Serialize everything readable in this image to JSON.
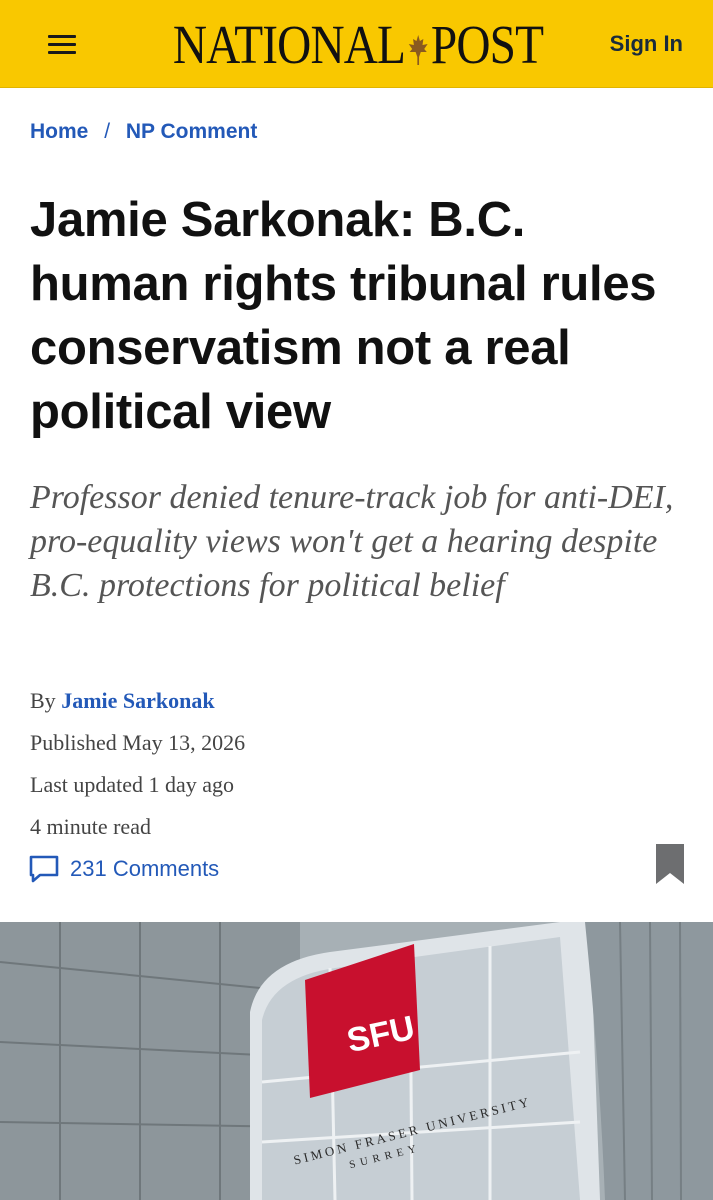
{
  "header": {
    "brand_left": "NATIONAL",
    "brand_right": "POST",
    "signin_label": "Sign In",
    "bg_color": "#f9c800",
    "menu_icon": "hamburger-menu-icon",
    "leaf_icon": "maple-leaf-icon"
  },
  "breadcrumb": {
    "home": "Home",
    "separator": "/",
    "section": "NP Comment",
    "link_color": "#2359b8"
  },
  "article": {
    "headline": "Jamie Sarkonak: B.C. human rights tribunal rules conservatism not a real political view",
    "dek": "Professor denied tenure-track job for anti-DEI, pro-equality views won't get a hearing despite B.C. protections for political belief",
    "byline_prefix": "By",
    "author": "Jamie Sarkonak",
    "published": "Published May 13, 2026",
    "updated": "Last updated 1 day ago",
    "read_time": "4 minute read",
    "comments_label": "231 Comments",
    "comment_icon": "speech-bubble-icon",
    "bookmark_icon": "bookmark-icon"
  },
  "hero_image": {
    "sign_text": "SFU",
    "sign_subtext": "SIMON FRASER UNIVERSITY",
    "sign_location": "SURREY",
    "sign_color": "#c8102e"
  }
}
